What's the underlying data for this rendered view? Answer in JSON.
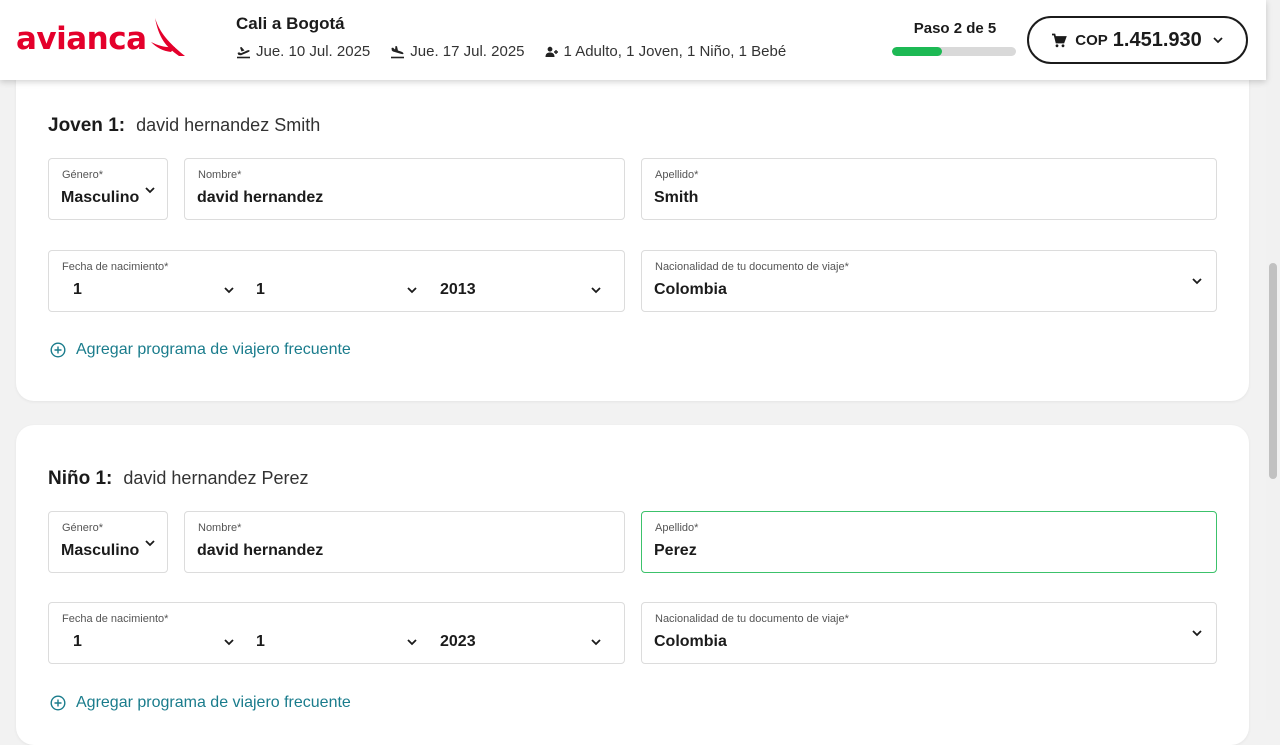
{
  "brand": {
    "name": "avianca",
    "color": "#e4002b"
  },
  "header": {
    "route": "Cali a Bogotá",
    "departure_date": "Jue. 10 Jul. 2025",
    "return_date": "Jue. 17 Jul. 2025",
    "passengers": "1 Adulto, 1 Joven, 1 Niño, 1 Bebé",
    "step_label": "Paso 2 de 5",
    "step_progress_fraction": 0.4,
    "cart_currency": "COP",
    "cart_amount": "1.451.930"
  },
  "labels": {
    "gender": "Género*",
    "first_name": "Nombre*",
    "last_name": "Apellido*",
    "birth_date": "Fecha de nacimiento*",
    "nationality": "Nacionalidad de tu documento de viaje*",
    "frequent_flyer": "Agregar programa de viajero frecuente"
  },
  "passengers": [
    {
      "type_label": "Joven 1:",
      "full_name": "david hernandez Smith",
      "gender": "Masculino",
      "first_name": "david hernandez",
      "last_name": "Smith",
      "birth_day": "1",
      "birth_month": "1",
      "birth_year": "2013",
      "nationality": "Colombia"
    },
    {
      "type_label": "Niño 1:",
      "full_name": "david hernandez Perez",
      "gender": "Masculino",
      "first_name": "david hernandez",
      "last_name": "Perez",
      "birth_day": "1",
      "birth_month": "1",
      "birth_year": "2023",
      "nationality": "Colombia"
    }
  ],
  "colors": {
    "accent_link": "#1a7c8c",
    "progress": "#1db954",
    "active_field": "#3cc26b"
  }
}
